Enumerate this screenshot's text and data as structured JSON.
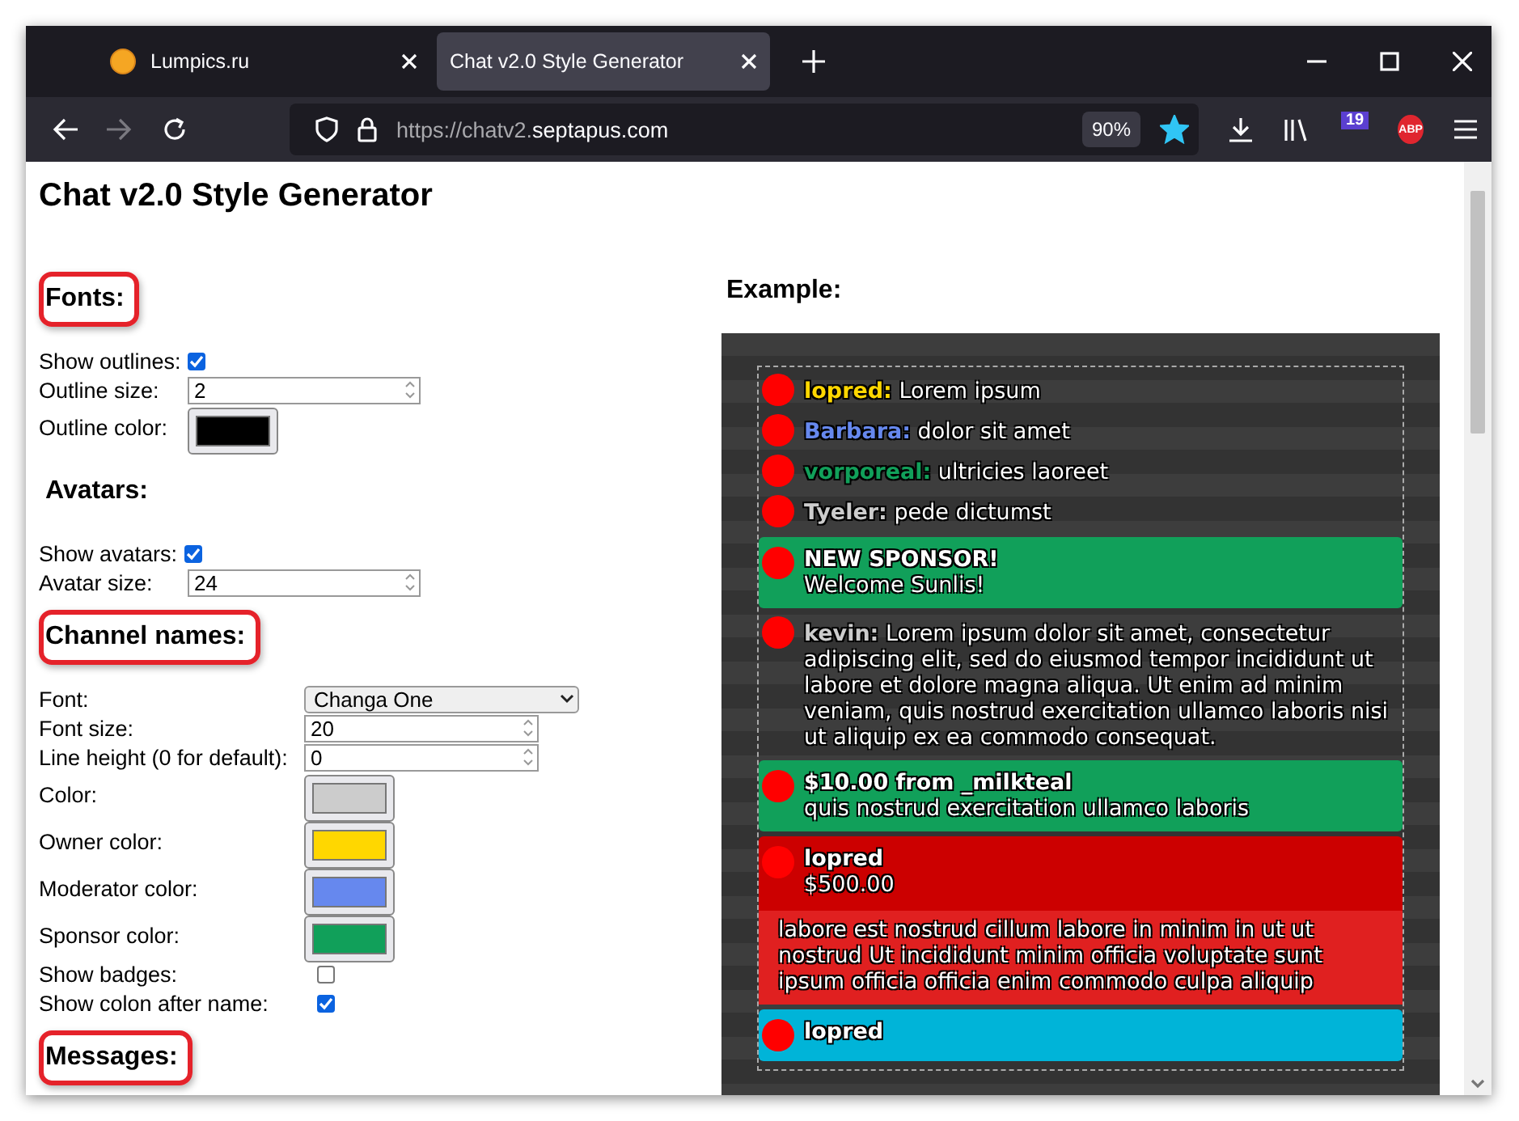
{
  "browser": {
    "tabs": [
      {
        "title": "Lumpics.ru",
        "selected": false
      },
      {
        "title": "Chat v2.0 Style Generator",
        "selected": true
      }
    ],
    "url_prefix": "https://chatv2.",
    "url_domain": "septapus.com",
    "zoom": "90%",
    "extension_badge": "19",
    "abp_label": "ABP"
  },
  "page": {
    "title": "Chat v2.0 Style Generator",
    "sections": [
      {
        "heading": "Fonts:",
        "highlighted": true,
        "rows": [
          {
            "kind": "checkbox",
            "label": "Show outlines:",
            "checked": true
          },
          {
            "kind": "number",
            "label": "Outline size:",
            "value": "2"
          },
          {
            "kind": "color",
            "label": "Outline color:",
            "color": "#000000"
          }
        ]
      },
      {
        "heading": "Avatars:",
        "highlighted": false,
        "rows": [
          {
            "kind": "checkbox",
            "label": "Show avatars:",
            "checked": true
          },
          {
            "kind": "number",
            "label": "Avatar size:",
            "value": "24"
          }
        ]
      },
      {
        "heading": "Channel names:",
        "highlighted": true,
        "rows": [
          {
            "kind": "select",
            "label": "Font:",
            "value": "Changa One"
          },
          {
            "kind": "number",
            "label": "Font size:",
            "value": "20"
          },
          {
            "kind": "number",
            "label": "Line height (0 for default):",
            "value": "0"
          },
          {
            "kind": "color",
            "label": "Color:",
            "color": "#cccccc"
          },
          {
            "kind": "color",
            "label": "Owner color:",
            "color": "#ffd700"
          },
          {
            "kind": "color",
            "label": "Moderator color:",
            "color": "#6688ee"
          },
          {
            "kind": "color",
            "label": "Sponsor color:",
            "color": "#11a05a"
          },
          {
            "kind": "checkbox",
            "label": "Show badges:",
            "checked": false
          },
          {
            "kind": "checkbox",
            "label": "Show colon after name:",
            "checked": true
          }
        ]
      },
      {
        "heading": "Messages:",
        "highlighted": true
      }
    ],
    "example": {
      "heading": "Example:",
      "messages": [
        {
          "kind": "chat",
          "name": "lopred:",
          "color": "#ffd700",
          "text": "Lorem ipsum"
        },
        {
          "kind": "chat",
          "name": "Barbara:",
          "color": "#6688ee",
          "text": "dolor sit amet"
        },
        {
          "kind": "chat",
          "name": "vorporeal:",
          "color": "#11a05a",
          "text": "ultricies laoreet"
        },
        {
          "kind": "chat",
          "name": "Tyeler:",
          "color": "#cccccc",
          "text": "pede dictumst"
        },
        {
          "kind": "card",
          "color": "#11a05a",
          "title": "NEW SPONSOR!",
          "text": "Welcome Sunlis!"
        },
        {
          "kind": "chat",
          "name": "kevin:",
          "color": "#cccccc",
          "text": "Lorem ipsum dolor sit amet, consectetur adipiscing elit, sed do eiusmod tempor incididunt ut labore et dolore magna aliqua. Ut enim ad minim veniam, quis nostrud exercitation ullamco laboris nisi ut aliquip ex ea commodo consequat."
        },
        {
          "kind": "card",
          "color": "#11a05a",
          "title": "$10.00 from _milkteal",
          "text": "quis nostrud exercitation ullamco laboris"
        },
        {
          "kind": "donation",
          "color": "#cc0000",
          "title": "lopred",
          "text": "$500.00",
          "message": "labore est nostrud cillum labore in minim in ut ut nostrud Ut incididunt minim officia voluptate sunt ipsum officia officia enim commodo culpa aliquip"
        },
        {
          "kind": "card",
          "color": "#00b4d8",
          "title": "lopred"
        }
      ]
    }
  }
}
